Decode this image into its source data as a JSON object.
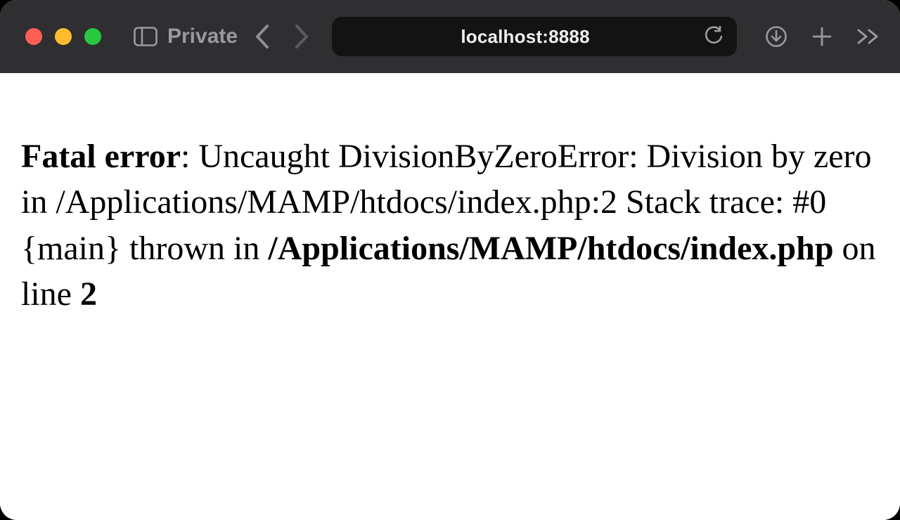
{
  "toolbar": {
    "private_label": "Private",
    "address": "localhost:8888"
  },
  "error": {
    "label": "Fatal error",
    "message_pre": ": Uncaught DivisionByZeroError: Division by zero in /Applications/MAMP/htdocs/index.php:2 Stack trace: #0 {main} thrown in ",
    "file": "/Applications/MAMP/htdocs/index.php",
    "on_line_text": " on line ",
    "line": "2"
  }
}
